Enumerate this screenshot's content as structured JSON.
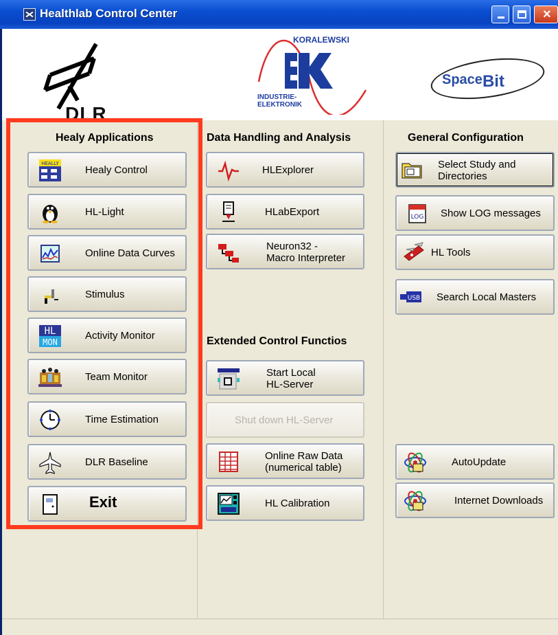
{
  "window": {
    "title": "Healthlab Control Center"
  },
  "logos": {
    "dlr": "DLR",
    "koralewski_name": "KORALEWSKI",
    "koralewski_line1": "INDUSTRIE-",
    "koralewski_line2": "ELEKTRONIK",
    "spacebit_a": "Space",
    "spacebit_b": "Bit"
  },
  "sections": {
    "healy_applications": "Healy Applications",
    "data_handling": "Data Handling and Analysis",
    "general_config": "General Configuration",
    "extended_control": "Extended Control Functios"
  },
  "healy_buttons": [
    {
      "label": "Healy Control",
      "icon": "healy-icon"
    },
    {
      "label": "HL-Light",
      "icon": "penguin-icon"
    },
    {
      "label": "Online Data Curves",
      "icon": "curves-icon"
    },
    {
      "label": "Stimulus",
      "icon": "stimulus-icon"
    },
    {
      "label": "Activity Monitor",
      "icon": "hl-mon-icon"
    },
    {
      "label": "Team Monitor",
      "icon": "team-icon"
    },
    {
      "label": "Time Estimation",
      "icon": "clock-icon"
    },
    {
      "label": "DLR Baseline",
      "icon": "airplane-icon"
    },
    {
      "label": "Exit",
      "icon": "exit-icon"
    }
  ],
  "data_buttons": [
    {
      "label": "HLExplorer",
      "icon": "pulse-icon"
    },
    {
      "label": "HLabExport",
      "icon": "export-icon"
    },
    {
      "label_line1": "Neuron32 -",
      "label_line2": "Macro Interpreter",
      "icon": "neuron-icon"
    }
  ],
  "extended_buttons": [
    {
      "label_line1": "Start Local",
      "label_line2": "HL-Server",
      "icon": "server-icon"
    },
    {
      "label": "Shut down HL-Server",
      "icon": ""
    },
    {
      "label_line1": "Online Raw Data",
      "label_line2": "(numerical table)",
      "icon": "table-icon"
    },
    {
      "label": "HL Calibration",
      "icon": "calibration-icon"
    }
  ],
  "general_buttons": [
    {
      "label_line1": "Select Study and",
      "label_line2": "Directories",
      "icon": "folder-icon"
    },
    {
      "label": "Show LOG messages",
      "icon": "log-icon"
    },
    {
      "label": "HL Tools",
      "icon": "tools-icon"
    },
    {
      "label": "Search Local Masters",
      "icon": "usb-icon"
    },
    {
      "label": "AutoUpdate",
      "icon": "update-icon"
    },
    {
      "label": "Internet Downloads",
      "icon": "download-icon"
    }
  ],
  "badges": {
    "healy_icon_text": "HEALLY",
    "hl_mon_text_1": "HL",
    "hl_mon_text_2": "MON",
    "log_text": "LOG",
    "usb_text": "USB"
  },
  "colors": {
    "highlight_box": "#ff3b1f",
    "titlebar": "#0a4ed0"
  }
}
